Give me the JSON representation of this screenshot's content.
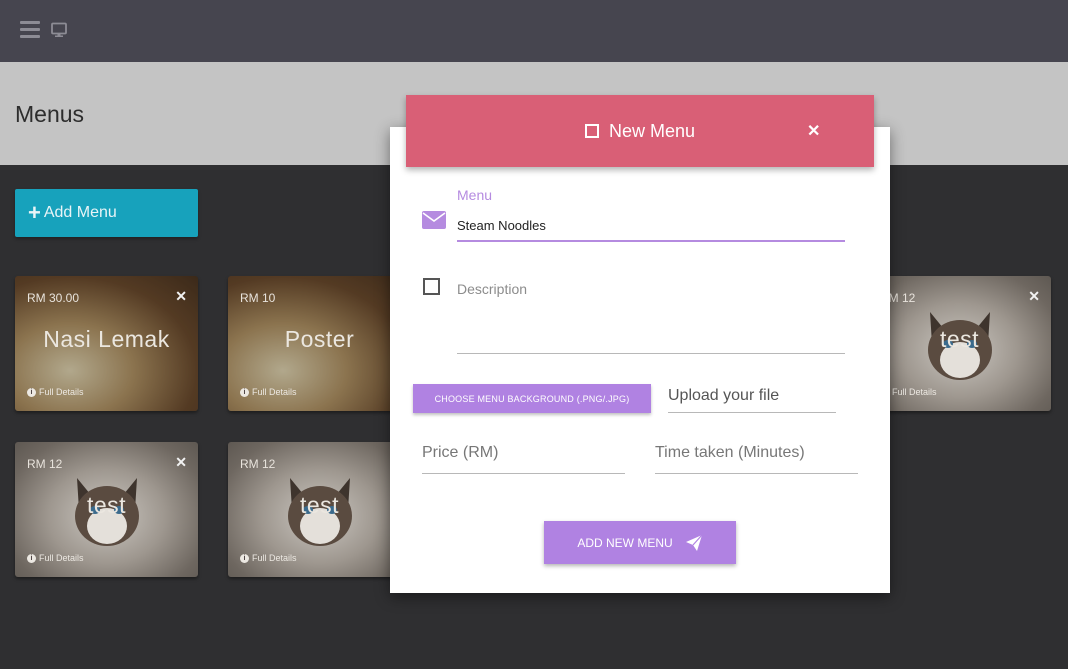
{
  "page": {
    "title": "Menus"
  },
  "topbar": {
    "icons": [
      "hamburger-icon",
      "monitor-icon"
    ]
  },
  "toolbar": {
    "add_menu_label": "Add Menu",
    "add_menu_icon": "plus-icon"
  },
  "cards": [
    {
      "price": "RM 30.00",
      "name": "Nasi Lemak",
      "details": "Full Details",
      "image": "food"
    },
    {
      "price": "RM 10",
      "name": "Poster",
      "details": "Full Details",
      "image": "food"
    },
    {
      "price": "RM 12",
      "name": "test",
      "details": "Full Details",
      "image": "cat"
    },
    {
      "price": "RM 12",
      "name": "test",
      "details": "Full Details",
      "image": "cat"
    },
    {
      "price": "RM 12",
      "name": "test",
      "details": "Full Details",
      "image": "cat"
    }
  ],
  "modal": {
    "title": "New Menu",
    "header_icon": "square-outline-icon",
    "close_icon": "close-icon",
    "menu_label": "Menu",
    "menu_value": "Steam Noodles",
    "menu_icon": "envelope-icon",
    "description_placeholder": "Description",
    "description_icon": "square-outline-icon",
    "choose_bg_label": "CHOOSE MENU BACKGROUND (.PNG/.JPG)",
    "upload_placeholder": "Upload your file",
    "price_placeholder": "Price (RM)",
    "time_placeholder": "Time taken (Minutes)",
    "submit_label": "ADD NEW MENU",
    "submit_icon": "paper-plane-icon"
  },
  "colors": {
    "topbar": "#46454f",
    "header_band": "#c4c4c4",
    "accent_teal": "#17a2bc",
    "modal_header": "#d95f76",
    "accent_purple": "#b082e2"
  }
}
